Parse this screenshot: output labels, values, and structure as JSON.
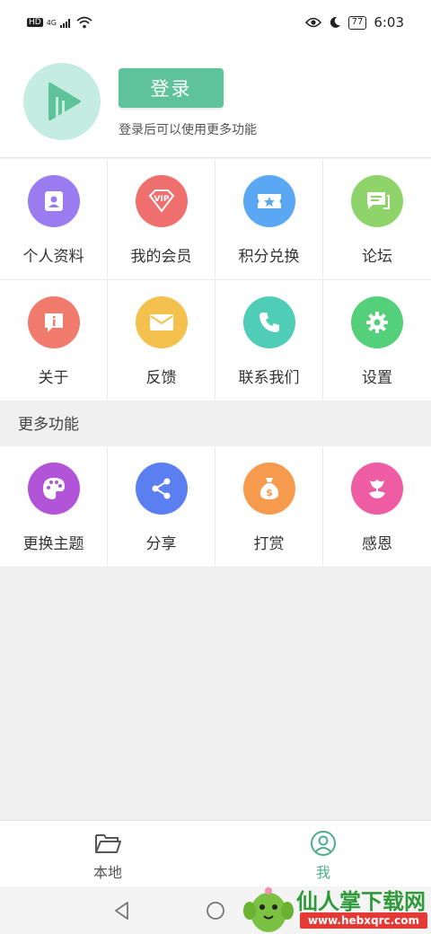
{
  "status_bar": {
    "hd": "HD",
    "network": "4G",
    "battery": "77",
    "time": "6:03"
  },
  "header": {
    "login_label": "登录",
    "login_hint": "登录后可以使用更多功能"
  },
  "menu": [
    {
      "label": "个人资料",
      "icon": "profile-icon",
      "color": "#9b7cf0"
    },
    {
      "label": "我的会员",
      "icon": "vip-icon",
      "color": "#ef6f6f",
      "badge": "VIP"
    },
    {
      "label": "积分兑换",
      "icon": "ticket-icon",
      "color": "#5aa7f3"
    },
    {
      "label": "论坛",
      "icon": "chat-icon",
      "color": "#8fd46a"
    },
    {
      "label": "关于",
      "icon": "info-icon",
      "color": "#f07a6c"
    },
    {
      "label": "反馈",
      "icon": "mail-icon",
      "color": "#f4c04e"
    },
    {
      "label": "联系我们",
      "icon": "phone-icon",
      "color": "#4fcdb6"
    },
    {
      "label": "设置",
      "icon": "gear-icon",
      "color": "#55d07a"
    }
  ],
  "more_section": {
    "title": "更多功能",
    "items": [
      {
        "label": "更换主题",
        "icon": "palette-icon",
        "color": "#b254d8"
      },
      {
        "label": "分享",
        "icon": "share-icon",
        "color": "#5b7ff0"
      },
      {
        "label": "打赏",
        "icon": "money-bag-icon",
        "color": "#f69a4e"
      },
      {
        "label": "感恩",
        "icon": "flower-icon",
        "color": "#ee5ca3"
      }
    ]
  },
  "tab_bar": {
    "tabs": [
      {
        "label": "本地",
        "icon": "folder-icon",
        "active": false
      },
      {
        "label": "我",
        "icon": "user-icon",
        "active": true
      }
    ],
    "active_color": "#4caf8a",
    "inactive_color": "#555555"
  },
  "watermark": {
    "title": "仙人掌下载网",
    "url": "www.hebxqrc.com"
  }
}
